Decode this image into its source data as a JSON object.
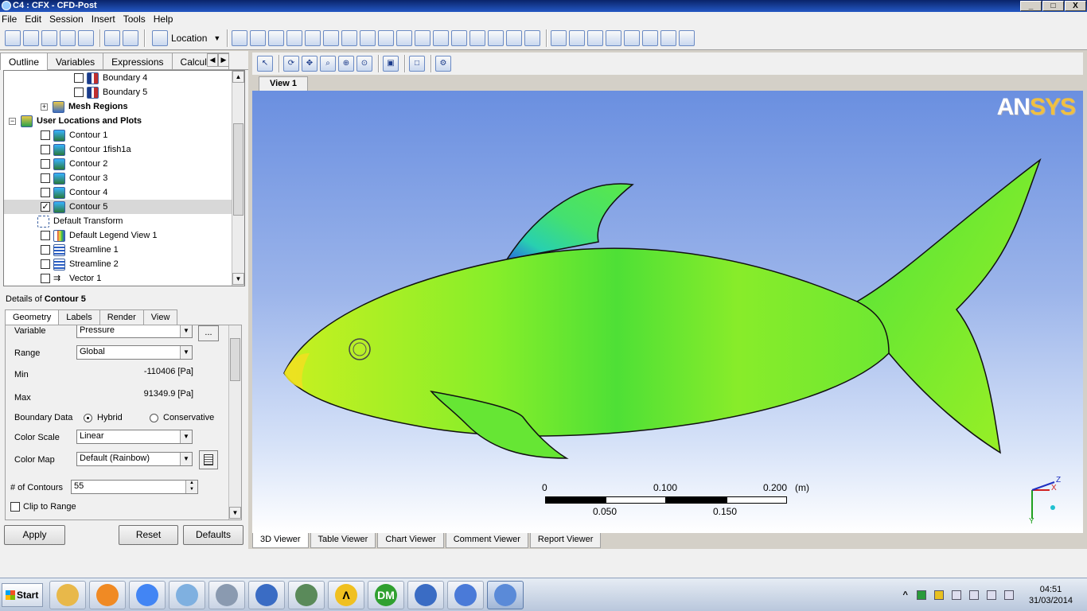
{
  "window": {
    "title": "C4 : CFX - CFD-Post",
    "minimize": "_",
    "maximize": "□",
    "close": "X"
  },
  "menu": [
    "File",
    "Edit",
    "Session",
    "Insert",
    "Tools",
    "Help"
  ],
  "toolbar": {
    "location_label": "Location",
    "location_arrow": "▼",
    "icons_left": [
      "new-icon",
      "open-icon",
      "save-state-icon",
      "refresh-icon",
      "screenshot-icon",
      "undo-icon",
      "redo-icon"
    ],
    "icons_right": [
      "translate-icon",
      "contour-icon",
      "streamline-icon",
      "volume-render-icon",
      "isosurface-icon",
      "text-icon",
      "clip-plane-icon",
      "legend-icon",
      "instance-transform-icon",
      "coordinate-frame-icon",
      "color-icon",
      "variable-icon",
      "expression-icon",
      "table-icon",
      "chart-icon",
      "comment-icon",
      "figure-icon",
      "timestep-icon",
      "animation-icon",
      "quick-edit-icon",
      "probe-icon",
      "macro-icon",
      "function-icon",
      "case-compare-icon",
      "command-editor-icon"
    ]
  },
  "outline_tabs": [
    "Outline",
    "Variables",
    "Expressions",
    "Calculato"
  ],
  "tab_scroll": [
    "◀",
    "▶"
  ],
  "tree": {
    "expand_glyph": "+",
    "collapse_glyph": "−",
    "check_glyph": "✓",
    "scroll_up": "▲",
    "scroll_down": "▼",
    "items": [
      {
        "label": "Boundary 4",
        "checked": false,
        "icon": "boundary",
        "bold": false
      },
      {
        "label": "Boundary 5",
        "checked": false,
        "icon": "boundary",
        "bold": false
      },
      {
        "label": "Mesh Regions",
        "checked": null,
        "icon": "mesh",
        "bold": true
      },
      {
        "label": "User Locations and Plots",
        "checked": null,
        "icon": "user",
        "bold": true
      },
      {
        "label": "Contour 1",
        "checked": false,
        "icon": "contour",
        "bold": false
      },
      {
        "label": "Contour 1fish1a",
        "checked": false,
        "icon": "contour",
        "bold": false
      },
      {
        "label": "Contour 2",
        "checked": false,
        "icon": "contour",
        "bold": false
      },
      {
        "label": "Contour 3",
        "checked": false,
        "icon": "contour",
        "bold": false
      },
      {
        "label": "Contour 4",
        "checked": false,
        "icon": "contour",
        "bold": false
      },
      {
        "label": "Contour 5",
        "checked": true,
        "icon": "contour",
        "bold": false,
        "selected": true
      },
      {
        "label": "Default Transform",
        "checked": null,
        "icon": "transform",
        "bold": false
      },
      {
        "label": "Default Legend View 1",
        "checked": false,
        "icon": "legend",
        "bold": false
      },
      {
        "label": "Streamline 1",
        "checked": false,
        "icon": "stream",
        "bold": false
      },
      {
        "label": "Streamline 2",
        "checked": false,
        "icon": "stream",
        "bold": false
      },
      {
        "label": "Vector 1",
        "checked": false,
        "icon": "vector",
        "bold": false
      }
    ]
  },
  "details": {
    "prefix": "Details of",
    "object": "Contour 5",
    "tabs": [
      "Geometry",
      "Labels",
      "Render",
      "View"
    ],
    "variable_label": "Variable",
    "variable_value": "Pressure",
    "variable_button": "...",
    "range_label": "Range",
    "range_value": "Global",
    "min_label": "Min",
    "min_value": "-110406 [Pa]",
    "max_label": "Max",
    "max_value": "91349.9 [Pa]",
    "boundary_label": "Boundary Data",
    "boundary_hybrid": "Hybrid",
    "boundary_conservative": "Conservative",
    "color_scale_label": "Color Scale",
    "color_scale_value": "Linear",
    "color_map_label": "Color Map",
    "color_map_value": "Default (Rainbow)",
    "contours_label": "# of Contours",
    "contours_value": "55",
    "clip_label": "Clip to Range",
    "dropdown_glyph": "▼",
    "spin_up": "▲",
    "spin_down": "▼"
  },
  "actions": {
    "apply": "Apply",
    "reset": "Reset",
    "defaults": "Defaults"
  },
  "viewer": {
    "view_tab": "View 1",
    "logo_an": "AN",
    "logo_sys": "SYS",
    "scale": {
      "top": [
        "0",
        "0.100",
        "0.200"
      ],
      "unit": "(m)",
      "bottom": [
        "0.050",
        "0.150"
      ]
    },
    "axes": {
      "x": "X",
      "y": "Y",
      "z": "Z"
    },
    "tabs": [
      "3D Viewer",
      "Table Viewer",
      "Chart Viewer",
      "Comment Viewer",
      "Report Viewer"
    ]
  },
  "taskbar": {
    "start": "Start",
    "apps": [
      {
        "name": "explorer",
        "glyph": "",
        "color": "#e8b84a"
      },
      {
        "name": "media-player",
        "glyph": "",
        "color": "#f08a24"
      },
      {
        "name": "chrome",
        "glyph": "",
        "color": "#4285f4"
      },
      {
        "name": "paint",
        "glyph": "",
        "color": "#7fb0e0"
      },
      {
        "name": "calculator",
        "glyph": "",
        "color": "#8a9ab0"
      },
      {
        "name": "remote-desktop",
        "glyph": "",
        "color": "#3a6cc4"
      },
      {
        "name": "network",
        "glyph": "",
        "color": "#5a8a5a"
      },
      {
        "name": "ansys-workbench",
        "glyph": "Λ",
        "color": "#f0c020"
      },
      {
        "name": "design-modeler",
        "glyph": "DM",
        "color": "#30a030"
      },
      {
        "name": "icem",
        "glyph": "",
        "color": "#3a6cc4"
      },
      {
        "name": "cfx-pre",
        "glyph": "",
        "color": "#4a7ad8"
      },
      {
        "name": "cfd-post",
        "glyph": "",
        "color": "#5a8ad8"
      }
    ],
    "tray_show_hidden": "^",
    "time": "04:51",
    "date": "31/03/2014"
  }
}
